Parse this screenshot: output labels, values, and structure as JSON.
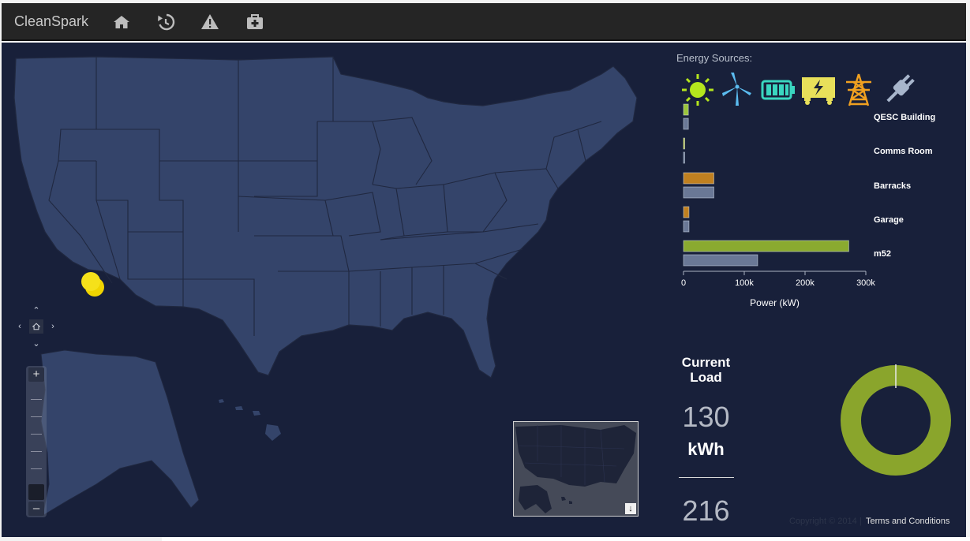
{
  "app": {
    "title": "CleanSpark"
  },
  "nav": {
    "icons": [
      "home-icon",
      "history-icon",
      "warning-icon",
      "medkit-icon"
    ]
  },
  "map": {
    "marker_color": "#f5e11a",
    "land_color": "#34446a",
    "water_color": "#18203a",
    "pan_home_icon": "home-icon"
  },
  "energy_sources": {
    "title": "Energy Sources:",
    "icons": [
      {
        "name": "solar-icon",
        "color": "#b5e61d"
      },
      {
        "name": "wind-turbine-icon",
        "color": "#5bbcf0"
      },
      {
        "name": "battery-icon",
        "color": "#3ad6c0"
      },
      {
        "name": "generator-icon",
        "color": "#e8e05a"
      },
      {
        "name": "power-tower-icon",
        "color": "#f0a020"
      },
      {
        "name": "plug-icon",
        "color": "#a8b6cc"
      }
    ]
  },
  "chart_data": {
    "type": "bar",
    "orientation": "horizontal",
    "categories": [
      "QESC Building",
      "Comms Room",
      "Barracks",
      "Garage",
      "m52"
    ],
    "series": [
      {
        "bar_colors": [
          "#9ac43a",
          "#d4e430",
          "#c08020",
          "#c08020",
          "#8aaa30"
        ],
        "values": [
          8000,
          1500,
          50000,
          9000,
          272000
        ]
      },
      {
        "bar_colors": [
          "#6a7896",
          "#6a7896",
          "#6a7896",
          "#6a7896",
          "#6a7896"
        ],
        "values": [
          8000,
          1500,
          50000,
          9000,
          122000
        ]
      }
    ],
    "xticks": [
      "0",
      "100k",
      "200k",
      "300k"
    ],
    "xlabel": "Power (kW)",
    "xlim": [
      0,
      300000
    ]
  },
  "current_load": {
    "title_line1": "Current",
    "title_line2": "Load",
    "value": "130",
    "unit": "kWh",
    "value2": "216"
  },
  "donut": {
    "color": "#8aa52c",
    "fraction": 0.99
  },
  "footer": {
    "copyright": "Copyright © 2014 |",
    "terms": "Terms and Conditions"
  }
}
